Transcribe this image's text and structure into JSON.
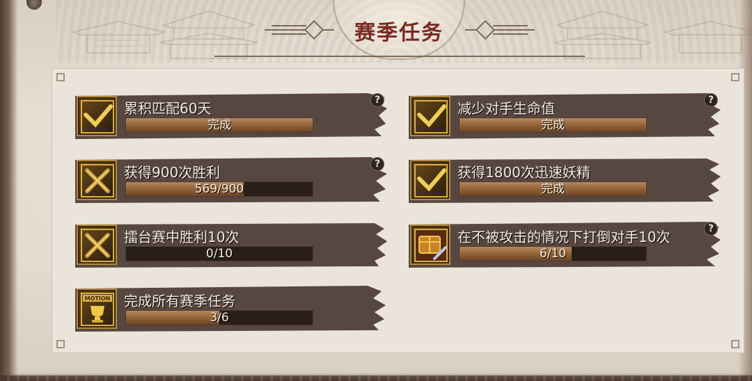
{
  "window": {
    "title": "赛季任务"
  },
  "colors": {
    "title": "#7a2a22",
    "bar_fill": "#9a6a3e",
    "bar_bg": "#2a1e18",
    "icon_gold": "#d8b04a",
    "brush": "#4a3a34"
  },
  "tasks": [
    {
      "label": "累积匹配60天",
      "progress_text": "完成",
      "progress": 1.0,
      "icon": "check-icon",
      "help": "?",
      "has_help": true
    },
    {
      "label": "获得900次胜利",
      "progress_text": "569/900",
      "progress": 0.632,
      "icon": "crossed-swords-icon",
      "help": "?",
      "has_help": true
    },
    {
      "label": "擂台赛中胜利10次",
      "progress_text": "0/10",
      "progress": 0.0,
      "icon": "crossed-swords-icon",
      "help": "",
      "has_help": false
    },
    {
      "label": "完成所有赛季任务",
      "progress_text": "3/6",
      "progress": 0.5,
      "icon": "motion-trophy-icon",
      "icon_text": "MOTION",
      "help": "",
      "has_help": false
    },
    {
      "label": "减少对手生命值",
      "progress_text": "完成",
      "progress": 1.0,
      "icon": "check-icon",
      "help": "?",
      "has_help": true
    },
    {
      "label": "获得1800次迅速妖精",
      "progress_text": "完成",
      "progress": 1.0,
      "icon": "check-icon",
      "help": "",
      "has_help": false
    },
    {
      "label": "在不被攻击的情况下打倒对手10次",
      "progress_text": "6/10",
      "progress": 0.6,
      "icon": "treasure-scroll-icon",
      "help": "?",
      "has_help": true
    }
  ]
}
